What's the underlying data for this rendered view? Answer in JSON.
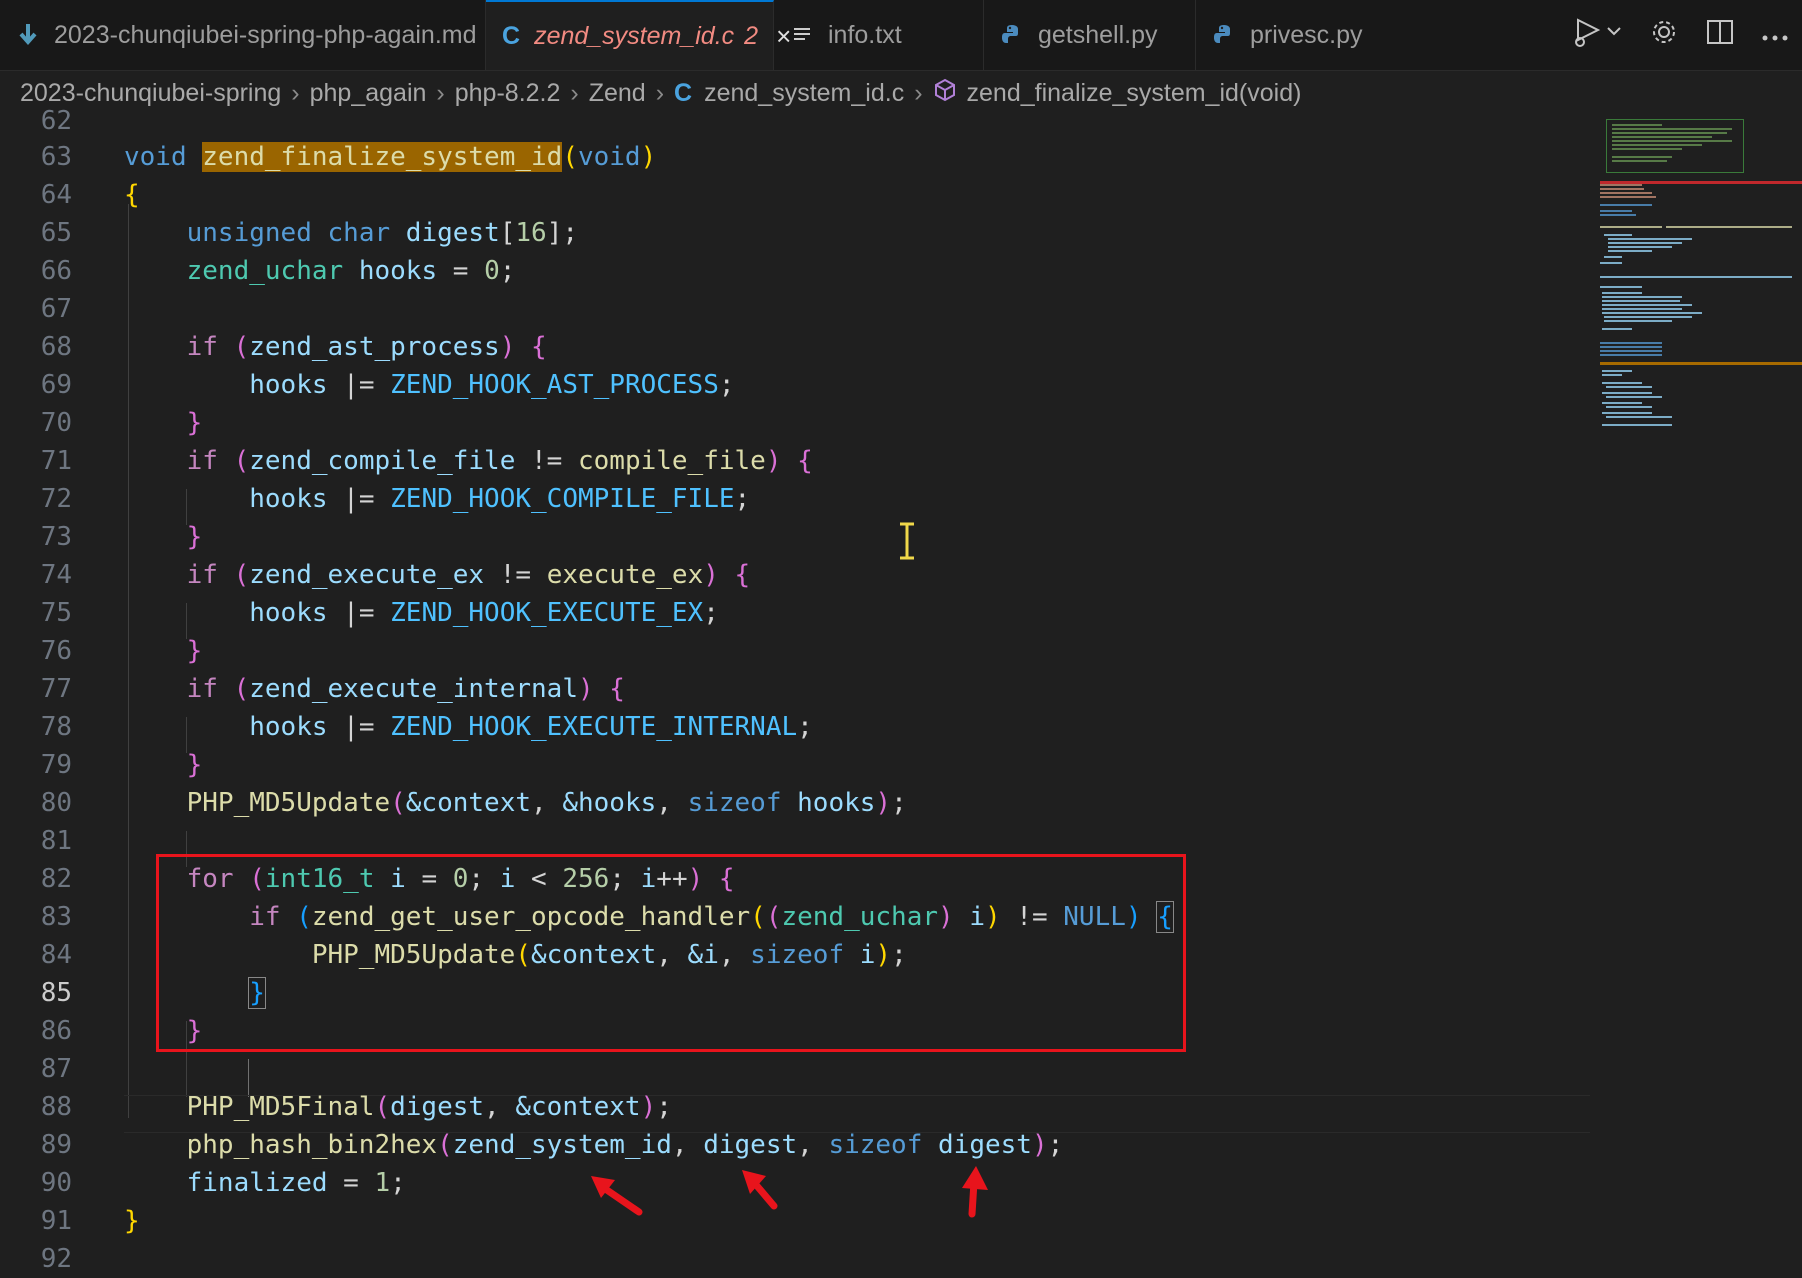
{
  "tabs": [
    {
      "label": "2023-chunqiubei-spring-php-again.md",
      "icon": "markdown-down-arrow-icon",
      "active": false
    },
    {
      "label": "zend_system_id.c",
      "badge": "2",
      "icon": "c-file-icon",
      "active": true,
      "close": "×"
    },
    {
      "label": "info.txt",
      "icon": "text-lines-icon",
      "active": false
    },
    {
      "label": "getshell.py",
      "icon": "python-icon",
      "active": false
    },
    {
      "label": "privesc.py",
      "icon": "python-icon",
      "active": false
    }
  ],
  "actions": [
    "run-debug-icon",
    "settings-gear-icon",
    "split-editor-icon",
    "more-actions-icon"
  ],
  "breadcrumb": [
    "2023-chunqiubei-spring",
    "php_again",
    "php-8.2.2",
    "Zend",
    "zend_system_id.c",
    "zend_finalize_system_id(void)"
  ],
  "editor": {
    "current_line": 85,
    "lines": [
      {
        "n": "62"
      },
      {
        "n": "63"
      },
      {
        "n": "64"
      },
      {
        "n": "65"
      },
      {
        "n": "66"
      },
      {
        "n": "67"
      },
      {
        "n": "68"
      },
      {
        "n": "69"
      },
      {
        "n": "70"
      },
      {
        "n": "71"
      },
      {
        "n": "72"
      },
      {
        "n": "73"
      },
      {
        "n": "74"
      },
      {
        "n": "75"
      },
      {
        "n": "76"
      },
      {
        "n": "77"
      },
      {
        "n": "78"
      },
      {
        "n": "79"
      },
      {
        "n": "80"
      },
      {
        "n": "81"
      },
      {
        "n": "82"
      },
      {
        "n": "83"
      },
      {
        "n": "84"
      },
      {
        "n": "85"
      },
      {
        "n": "86"
      },
      {
        "n": "87"
      },
      {
        "n": "88"
      },
      {
        "n": "89"
      },
      {
        "n": "90"
      },
      {
        "n": "91"
      },
      {
        "n": "92"
      }
    ],
    "code": {
      "l63": {
        "void": "void",
        "fn": "zend_finalize_system_id",
        "p1": "(",
        "arg": "void",
        "p2": ")"
      },
      "l64": {
        "b": "{"
      },
      "l65": {
        "k1": "unsigned",
        "k2": "char",
        "v": "digest",
        "o": "[",
        "n": "16",
        "c": "];"
      },
      "l66": {
        "t": "zend_uchar",
        "v": "hooks",
        "e": " = ",
        "n": "0",
        "s": ";"
      },
      "l68": {
        "kw": "if",
        "p1": "(",
        "v": "zend_ast_process",
        "p2": ")",
        "b": "{"
      },
      "l69": {
        "v": "hooks",
        "op": " |= ",
        "m": "ZEND_HOOK_AST_PROCESS",
        "s": ";"
      },
      "l70": {
        "b": "}"
      },
      "l71": {
        "kw": "if",
        "p1": "(",
        "v1": "zend_compile_file",
        "op": " != ",
        "v2": "compile_file",
        "p2": ")",
        "b": "{"
      },
      "l72": {
        "v": "hooks",
        "op": " |= ",
        "m": "ZEND_HOOK_COMPILE_FILE",
        "s": ";"
      },
      "l73": {
        "b": "}"
      },
      "l74": {
        "kw": "if",
        "p1": "(",
        "v1": "zend_execute_ex",
        "op": " != ",
        "v2": "execute_ex",
        "p2": ")",
        "b": "{"
      },
      "l75": {
        "v": "hooks",
        "op": " |= ",
        "m": "ZEND_HOOK_EXECUTE_EX",
        "s": ";"
      },
      "l76": {
        "b": "}"
      },
      "l77": {
        "kw": "if",
        "p1": "(",
        "v": "zend_execute_internal",
        "p2": ")",
        "b": "{"
      },
      "l78": {
        "v": "hooks",
        "op": " |= ",
        "m": "ZEND_HOOK_EXECUTE_INTERNAL",
        "s": ";"
      },
      "l79": {
        "b": "}"
      },
      "l80": {
        "f": "PHP_MD5Update",
        "p1": "(",
        "a1": "&context",
        "c1": ", ",
        "a2": "&hooks",
        "c2": ", ",
        "k": "sizeof",
        "a3": " hooks",
        "p2": ")",
        "s": ";"
      },
      "l82": {
        "kw": "for",
        "p1": "(",
        "t": "int16_t",
        "v": " i",
        "e": " = ",
        "n0": "0",
        "s1": "; ",
        "v2": "i",
        "lt": " < ",
        "n1": "256",
        "s2": "; ",
        "v3": "i",
        "inc": "++",
        "p2": ")",
        "b": "{"
      },
      "l83": {
        "kw": "if",
        "p1": "(",
        "f": "zend_get_user_opcode_handler",
        "p2": "(",
        "p3": "(",
        "t": "zend_uchar",
        "p4": ")",
        "v": " i",
        "p5": ")",
        "op": " != ",
        "m": "NULL",
        "p6": ")",
        "b": "{"
      },
      "l84": {
        "f": "PHP_MD5Update",
        "p1": "(",
        "a1": "&context",
        "c1": ", ",
        "a2": "&i",
        "c2": ", ",
        "k": "sizeof",
        "a3": " i",
        "p2": ")",
        "s": ";"
      },
      "l85": {
        "b": "}"
      },
      "l86": {
        "b": "}"
      },
      "l88": {
        "f": "PHP_MD5Final",
        "p1": "(",
        "a1": "digest",
        "c1": ", ",
        "a2": "&context",
        "p2": ")",
        "s": ";"
      },
      "l89": {
        "f": "php_hash_bin2hex",
        "p1": "(",
        "a1": "zend_system_id",
        "c1": ", ",
        "a2": "digest",
        "c2": ", ",
        "k": "sizeof",
        "a3": " digest",
        "p2": ")",
        "s": ";"
      },
      "l90": {
        "v": "finalized",
        "e": " = ",
        "n": "1",
        "s": ";"
      },
      "l91": {
        "b": "}"
      }
    }
  },
  "colors": {
    "annotation_red": "#e8141c",
    "tab_active_text": "#f28b82",
    "highlight": "#9a6500"
  }
}
